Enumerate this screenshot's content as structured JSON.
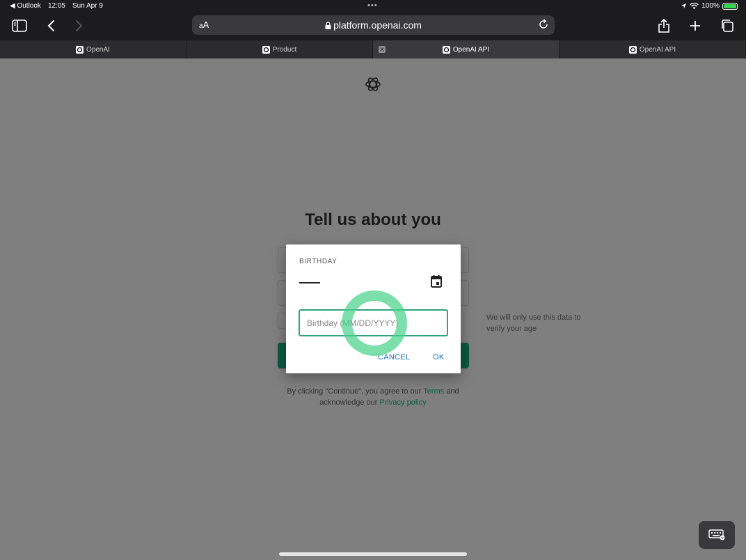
{
  "status_bar": {
    "back_app": "◀ Outlook",
    "time": "12:05",
    "date": "Sun Apr 9",
    "battery": "100%",
    "battery_level": 1.0
  },
  "url_bar": {
    "aa": "AA",
    "url": "platform.openai.com"
  },
  "tabs": [
    {
      "label": "OpenAI",
      "active": false
    },
    {
      "label": "Product",
      "active": false
    },
    {
      "label": "OpenAI API",
      "active": true
    },
    {
      "label": "OpenAI API",
      "active": false
    }
  ],
  "page": {
    "heading": "Tell us about you",
    "hint": "We will only use this data to verify your age",
    "legal_prefix": "By clicking \"Continue\", you agree to our",
    "terms_link": "Terms",
    "legal_and": "and",
    "legal_ack": "acknowledge our",
    "privacy_link": "Privacy policy"
  },
  "dialog": {
    "label": "BIRTHDAY",
    "input_placeholder": "Birthday (MM/DD/YYYY)",
    "input_value": "",
    "cancel": "CANCEL",
    "ok": "OK"
  },
  "colors": {
    "accent_green": "#0d5842",
    "dialog_button": "#1a73c9",
    "focus_border": "#2fa37d",
    "touch_indicator": "#4ad28c"
  }
}
